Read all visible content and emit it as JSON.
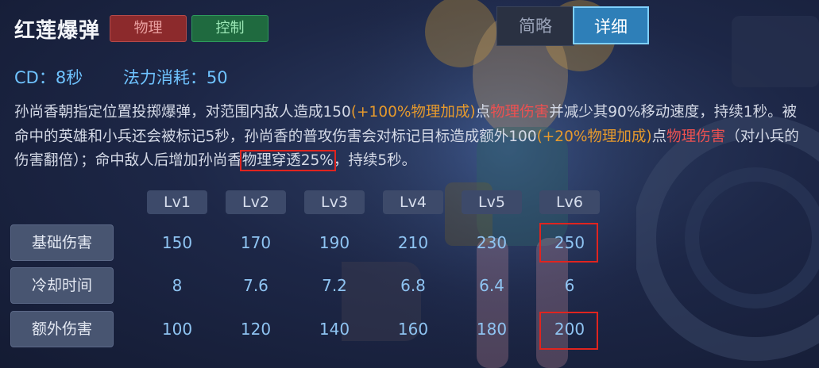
{
  "skill": {
    "name": "红莲爆弹",
    "tags": [
      "物理",
      "控制"
    ]
  },
  "view_toggle": {
    "brief": "简略",
    "detail": "详细"
  },
  "stats": {
    "cd": "CD：8秒",
    "mana": "法力消耗：50"
  },
  "description": {
    "p1": "孙尚香朝指定位置投掷爆弹，对范围内敌人造成150",
    "p2": "(+100%物理加成)",
    "p3": "点",
    "p4": "物理伤害",
    "p5": "并减少其90%移动速度，持续1秒。被命中的英雄和小兵还会被标记5秒，孙尚香的普攻伤害会对标记目标造成额外100",
    "p6": "(+20%物理加成)",
    "p7": "点",
    "p8": "物理伤害",
    "p9": "（对小兵的伤害翻倍）；命中敌人后增加孙尚香",
    "p10": "物理穿透25%",
    "p11": "，持续5秒。"
  },
  "levels": [
    "Lv1",
    "Lv2",
    "Lv3",
    "Lv4",
    "Lv5",
    "Lv6"
  ],
  "table": [
    {
      "label": "基础伤害",
      "values": [
        "150",
        "170",
        "190",
        "210",
        "230",
        "250"
      ]
    },
    {
      "label": "冷却时间",
      "values": [
        "8",
        "7.6",
        "7.2",
        "6.8",
        "6.4",
        "6"
      ]
    },
    {
      "label": "额外伤害",
      "values": [
        "100",
        "120",
        "140",
        "160",
        "180",
        "200"
      ]
    }
  ],
  "colors": {
    "accent_blue": "#2e7fb8",
    "physical": "#8c2a2c",
    "control": "#1f6a3f",
    "highlight": "#e0241f"
  }
}
